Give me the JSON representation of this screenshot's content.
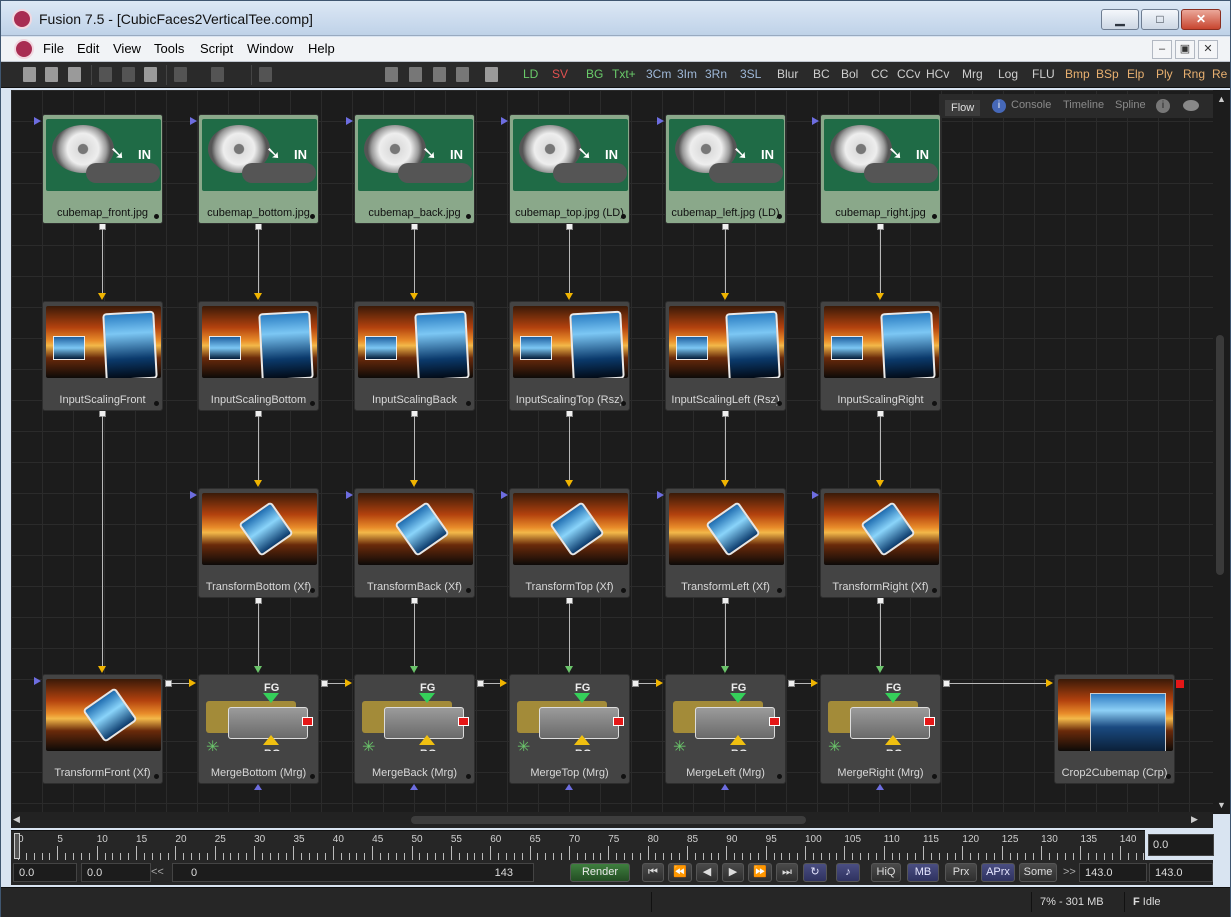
{
  "window": {
    "title": "Fusion 7.5 - [CubicFaces2VerticalTee.comp]",
    "minimize": "▁",
    "maximize": "□",
    "close": "✕"
  },
  "menu": {
    "items": [
      "File",
      "Edit",
      "View",
      "Tools",
      "Script",
      "Window",
      "Help"
    ],
    "mdi": [
      "–",
      "▣",
      "✕"
    ]
  },
  "toolbar": {
    "tools": [
      {
        "label": "LD",
        "color": "#6acb6a"
      },
      {
        "label": "SV",
        "color": "#e05050"
      },
      {
        "label": "BG",
        "color": "#6acb6a"
      },
      {
        "label": "Txt+",
        "color": "#6acb6a"
      },
      {
        "label": "3Cm",
        "color": "#9fb8d8"
      },
      {
        "label": "3Im",
        "color": "#9fb8d8"
      },
      {
        "label": "3Rn",
        "color": "#9fb8d8"
      },
      {
        "label": "3SL",
        "color": "#9fb8d8"
      },
      {
        "label": "Blur",
        "color": "#cfcfcf"
      },
      {
        "label": "BC",
        "color": "#cfcfcf"
      },
      {
        "label": "Bol",
        "color": "#cfcfcf"
      },
      {
        "label": "CC",
        "color": "#cfcfcf"
      },
      {
        "label": "CCv",
        "color": "#cfcfcf"
      },
      {
        "label": "HCv",
        "color": "#cfcfcf"
      },
      {
        "label": "Mrg",
        "color": "#cfcfcf"
      },
      {
        "label": "Log",
        "color": "#cfcfcf"
      },
      {
        "label": "FLU",
        "color": "#cfcfcf"
      },
      {
        "label": "Bmp",
        "color": "#e8b070"
      },
      {
        "label": "BSp",
        "color": "#e8b070"
      },
      {
        "label": "Elp",
        "color": "#e8b070"
      },
      {
        "label": "Ply",
        "color": "#e8b070"
      },
      {
        "label": "Rng",
        "color": "#e8b070"
      },
      {
        "label": "Re",
        "color": "#e8b070"
      }
    ]
  },
  "panel_tabs": {
    "flow": "Flow",
    "console": "Console",
    "timeline": "Timeline",
    "spline": "Spline"
  },
  "nodes": {
    "loaders": [
      "cubemap_front.jpg",
      "cubemap_bottom.jpg",
      "cubemap_back.jpg",
      "cubemap_top.jpg  (LD)",
      "cubemap_left.jpg  (LD)",
      "cubemap_right.jpg"
    ],
    "loader_in": "IN",
    "scalers": [
      "InputScalingFront",
      "InputScalingBottom",
      "InputScalingBack",
      "InputScalingTop  (Rsz)",
      "InputScalingLeft  (Rsz)",
      "InputScalingRight"
    ],
    "transforms": [
      "TransformBottom  (Xf)",
      "TransformBack  (Xf)",
      "TransformTop  (Xf)",
      "TransformLeft  (Xf)",
      "TransformRight  (Xf)"
    ],
    "transform_front": "TransformFront  (Xf)",
    "merges": [
      "MergeBottom  (Mrg)",
      "MergeBack  (Mrg)",
      "MergeTop  (Mrg)",
      "MergeLeft  (Mrg)",
      "MergeRight  (Mrg)"
    ],
    "merge_fg": "FG",
    "merge_bg": "BG",
    "crop": "Crop2Cubemap  (Crp)"
  },
  "timeline": {
    "ticks": [
      "0",
      "5",
      "10",
      "15",
      "20",
      "25",
      "30",
      "35",
      "40",
      "45",
      "50",
      "55",
      "60",
      "65",
      "70",
      "75",
      "80",
      "85",
      "90",
      "95",
      "100",
      "105",
      "110",
      "115",
      "120",
      "125",
      "130",
      "135",
      "140"
    ],
    "current": "0.0"
  },
  "transport": {
    "global_start": "0.0",
    "render_start": "0.0",
    "rewind": "<<",
    "range_start": "0",
    "range_end": "143",
    "render": "Render",
    "hiq": "HiQ",
    "mb": "MB",
    "prx": "Prx",
    "aprx": "APrx",
    "some": "Some",
    "ffwd": ">>",
    "render_end": "143.0",
    "global_end": "143.0"
  },
  "status": {
    "memory": "7% -  301 MB",
    "state_icon": "F",
    "state": "Idle"
  }
}
